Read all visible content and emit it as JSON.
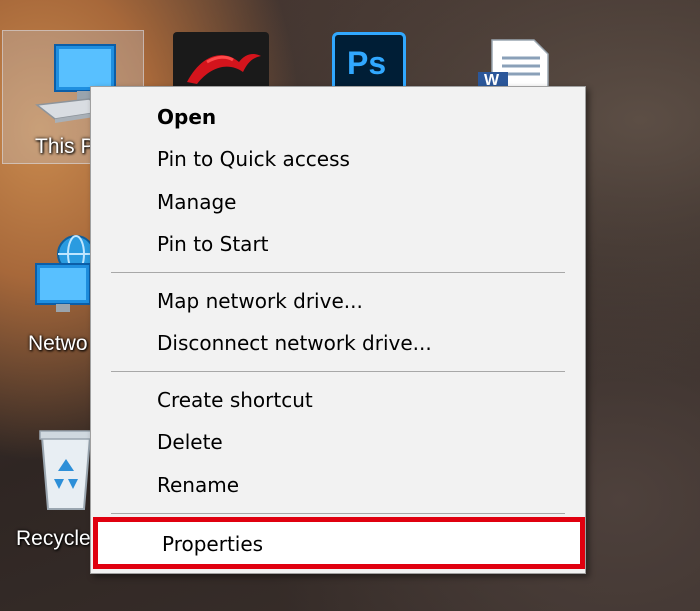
{
  "desktop": {
    "icons": [
      {
        "label": "This P"
      },
      {
        "label": "Netwo"
      },
      {
        "label": "Recycle"
      }
    ],
    "apps": [
      {
        "icon": "red-dragon-app-icon"
      },
      {
        "icon": "photoshop-icon",
        "text": "Ps"
      },
      {
        "icon": "word-document-icon",
        "text": "W"
      }
    ]
  },
  "context_menu": {
    "items": [
      {
        "label": "Open"
      },
      {
        "label": "Pin to Quick access"
      },
      {
        "label": "Manage"
      },
      {
        "label": "Pin to Start"
      },
      {
        "label": "Map network drive..."
      },
      {
        "label": "Disconnect network drive..."
      },
      {
        "label": "Create shortcut"
      },
      {
        "label": "Delete"
      },
      {
        "label": "Rename"
      },
      {
        "label": "Properties"
      }
    ],
    "highlight_color": "#e0000f"
  }
}
